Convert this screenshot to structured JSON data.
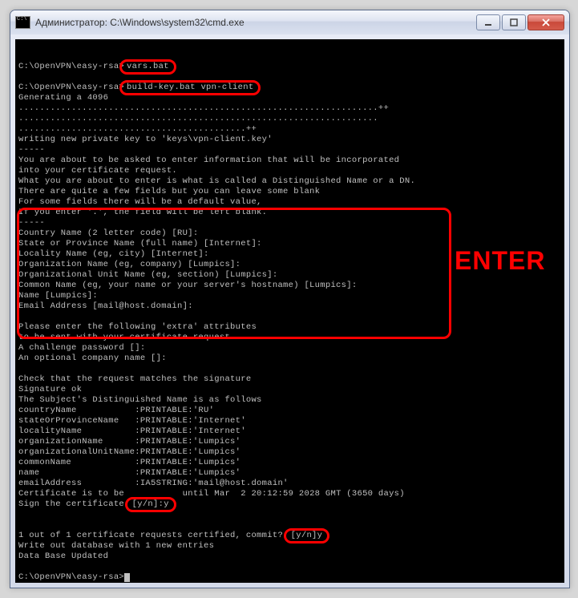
{
  "window": {
    "title": "Администратор: C:\\Windows\\system32\\cmd.exe",
    "icon_text": "C:\\"
  },
  "annotations": {
    "enter_label": "ENTER"
  },
  "console": {
    "prompt": "C:\\OpenVPN\\easy-rsa>",
    "cmd1": "vars.bat",
    "cmd2": "build-key.bat vpn-client",
    "gen_line": "Generating a 4096",
    "dots_row1": "....................................................................++",
    "dots_row2": "....................................................................",
    "dots_row3": "...........................................++",
    "write_key": "writing new private key to 'keys\\vpn-client.key'",
    "dashline": "-----",
    "info1": "You are about to be asked to enter information that will be incorporated",
    "info2": "into your certificate request.",
    "info3": "What you are about to enter is what is called a Distinguished Name or a DN.",
    "info4": "There are quite a few fields but you can leave some blank",
    "info5": "For some fields there will be a default value,",
    "info6": "If you enter '.', the field will be left blank.",
    "p_country": "Country Name (2 letter code) [RU]:",
    "p_state": "State or Province Name (full name) [Internet]:",
    "p_local": "Locality Name (eg, city) [Internet]:",
    "p_org": "Organization Name (eg, company) [Lumpics]:",
    "p_orgunit": "Organizational Unit Name (eg, section) [Lumpics]:",
    "p_common": "Common Name (eg, your name or your server's hostname) [Lumpics]:",
    "p_name": "Name [Lumpics]:",
    "p_email": "Email Address [mail@host.domain]:",
    "extra1": "Please enter the following 'extra' attributes",
    "extra2": "to be sent with your certificate request",
    "extra3": "A challenge password []:",
    "extra4": "An optional company name []:",
    "check": "Check that the request matches the signature",
    "sigok": "Signature ok",
    "subj": "The Subject's Distinguished Name is as follows",
    "dn_country": "countryName           :PRINTABLE:'RU'",
    "dn_state": "stateOrProvinceName   :PRINTABLE:'Internet'",
    "dn_local": "localityName          :PRINTABLE:'Internet'",
    "dn_org": "organizationName      :PRINTABLE:'Lumpics'",
    "dn_orgunit": "organizationalUnitName:PRINTABLE:'Lumpics'",
    "dn_common": "commonName            :PRINTABLE:'Lumpics'",
    "dn_name": "name                  :PRINTABLE:'Lumpics'",
    "dn_email": "emailAddress          :IA5STRING:'mail@host.domain'",
    "cert_pre": "Certificate is to be ",
    "cert_post": "until Mar  2 20:12:59 2028 GMT (3650 days)",
    "sign_pre": "Sign the certificate ",
    "sign_hl": "[y/n]:y",
    "commit_pre": "1 out of 1 certificate requests certified, commit? ",
    "commit_hl": "[y/n]y",
    "write_db": "Write out database with 1 new entries",
    "db_upd": "Data Base Updated"
  }
}
